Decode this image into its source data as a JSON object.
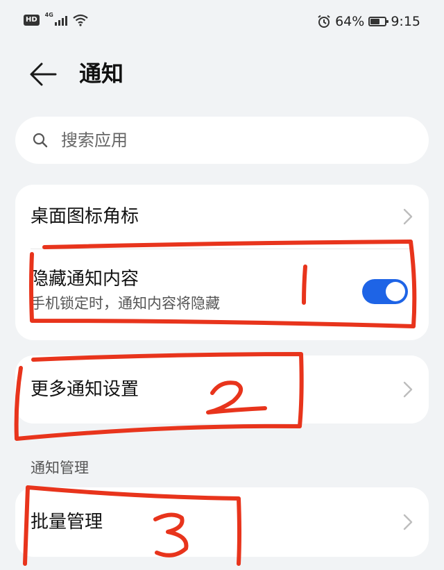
{
  "status_bar": {
    "hd": "HD",
    "network": "4G",
    "battery_percent_text": "64%",
    "battery_level": 0.64,
    "time": "9:15",
    "icons": [
      "signal-icon",
      "wifi-icon",
      "alarm-icon",
      "battery-icon"
    ]
  },
  "header": {
    "title": "通知",
    "back_icon": "back-arrow-icon"
  },
  "search": {
    "placeholder": "搜索应用",
    "icon": "search-icon"
  },
  "card1": {
    "badge_row": {
      "title": "桌面图标角标"
    },
    "hide_row": {
      "title": "隐藏通知内容",
      "subtitle": "手机锁定时，通知内容将隐藏",
      "toggle_on": true
    }
  },
  "card2": {
    "more_row": {
      "title": "更多通知设置"
    }
  },
  "section": {
    "label": "通知管理"
  },
  "card3": {
    "batch_row": {
      "title": "批量管理"
    }
  },
  "annotations": {
    "color": "#e8341c",
    "labels": [
      "1",
      "2",
      "3"
    ]
  },
  "colors": {
    "toggle_on": "#1e64e6",
    "background": "#f1f3f5"
  }
}
